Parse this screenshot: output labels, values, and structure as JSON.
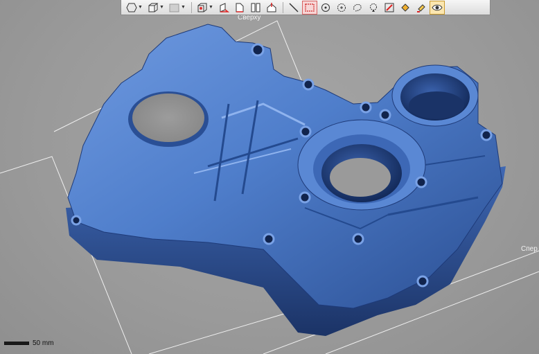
{
  "viewport": {
    "background": "#9c9c9c",
    "model_color": "#4a78c8",
    "label_top": "Сверху",
    "label_right": "Спер",
    "scale_label": "50 mm"
  },
  "toolbar": {
    "items": [
      {
        "icon": "hexagon-shape-icon",
        "dropdown": true
      },
      {
        "icon": "cube-wireframe-icon",
        "dropdown": true
      },
      {
        "icon": "shaded-box-icon",
        "dropdown": true
      },
      {
        "icon": "bounding-box-icon",
        "dropdown": true
      },
      {
        "icon": "section-plane-red-icon"
      },
      {
        "icon": "section-plane-icon"
      },
      {
        "icon": "split-view-icon"
      },
      {
        "icon": "home-view-icon"
      },
      {
        "icon": "line-measure-icon"
      },
      {
        "icon": "rect-select-icon",
        "state": "active"
      },
      {
        "icon": "point-select-icon"
      },
      {
        "icon": "circle-select-icon"
      },
      {
        "icon": "lasso-select-icon"
      },
      {
        "icon": "magic-select-icon"
      },
      {
        "icon": "pencil-select-icon"
      },
      {
        "icon": "fill-select-icon"
      },
      {
        "icon": "brush-select-icon"
      },
      {
        "icon": "visibility-eye-icon",
        "state": "selected"
      }
    ]
  }
}
